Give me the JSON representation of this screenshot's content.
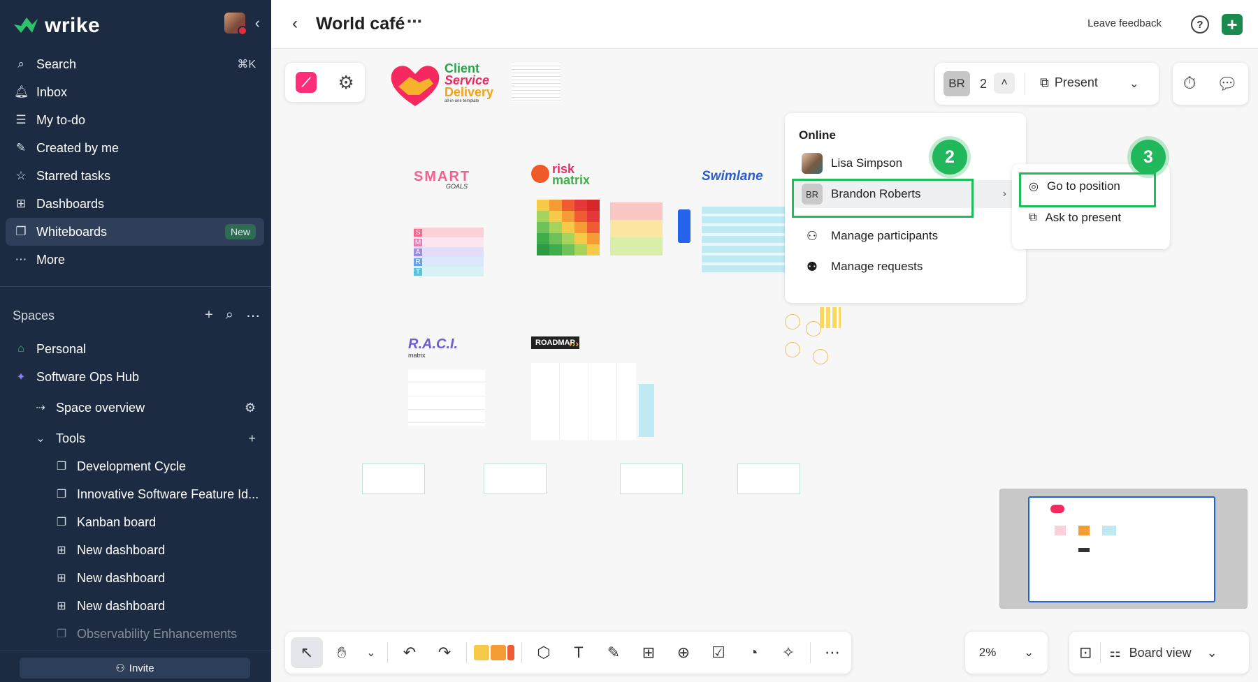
{
  "sidebar": {
    "logo": "wrike",
    "nav": [
      {
        "icon": "search-icon",
        "label": "Search",
        "shortcut": "⌘K"
      },
      {
        "icon": "bell-icon",
        "label": "Inbox"
      },
      {
        "icon": "todo-icon",
        "label": "My to-do"
      },
      {
        "icon": "created-icon",
        "label": "Created by me"
      },
      {
        "icon": "star-icon",
        "label": "Starred tasks"
      },
      {
        "icon": "dashboard-icon",
        "label": "Dashboards"
      },
      {
        "icon": "whiteboard-icon",
        "label": "Whiteboards",
        "badge": "New",
        "active": true
      },
      {
        "icon": "more-icon",
        "label": "More"
      }
    ],
    "spaces_label": "Spaces",
    "tree": [
      {
        "label": "Personal",
        "icon": "home-icon"
      },
      {
        "label": "Software Ops Hub",
        "icon": "sparkle-icon"
      },
      {
        "label": "Space overview"
      },
      {
        "label": "Tools"
      },
      {
        "label": "Development Cycle"
      },
      {
        "label": "Innovative Software Feature Id..."
      },
      {
        "label": "Kanban board"
      },
      {
        "label": "New dashboard"
      },
      {
        "label": "New dashboard"
      },
      {
        "label": "New dashboard"
      },
      {
        "label": "Observability Enhancements"
      }
    ],
    "invite": "Invite"
  },
  "header": {
    "title": "World café",
    "feedback": "Leave feedback",
    "help": "?"
  },
  "toolbar": {
    "user_initials": "BR",
    "user_count": "2",
    "present": "Present"
  },
  "online_menu": {
    "heading": "Online",
    "users": [
      {
        "name": "Lisa Simpson"
      },
      {
        "name": "Brandon Roberts",
        "initials": "BR"
      }
    ],
    "manage_participants": "Manage participants",
    "manage_requests": "Manage requests"
  },
  "submenu": {
    "go_to_position": "Go to position",
    "ask_to_present": "Ask to present"
  },
  "steps": [
    "2",
    "3"
  ],
  "board": {
    "client_title": [
      "Client",
      "Service",
      "Delivery"
    ],
    "client_sub": "all-in-one template",
    "smart": "SMART",
    "goals": "GOALS",
    "risk": "risk",
    "matrix": "matrix",
    "swimlane": "Swimlane",
    "raci": "R.A.C.I.",
    "raci_sub": "matrix",
    "roadmap": "ROADMAP",
    "smart_letters": [
      "S",
      "M",
      "A",
      "R",
      "T"
    ]
  },
  "bottom": {
    "zoom": "2%",
    "board_view": "Board view"
  },
  "colors": {
    "sidebar_bg": "#1c2b42",
    "accent_green": "#20b85a",
    "brand_green": "#1c8a4c",
    "pink": "#ff2d7a"
  }
}
